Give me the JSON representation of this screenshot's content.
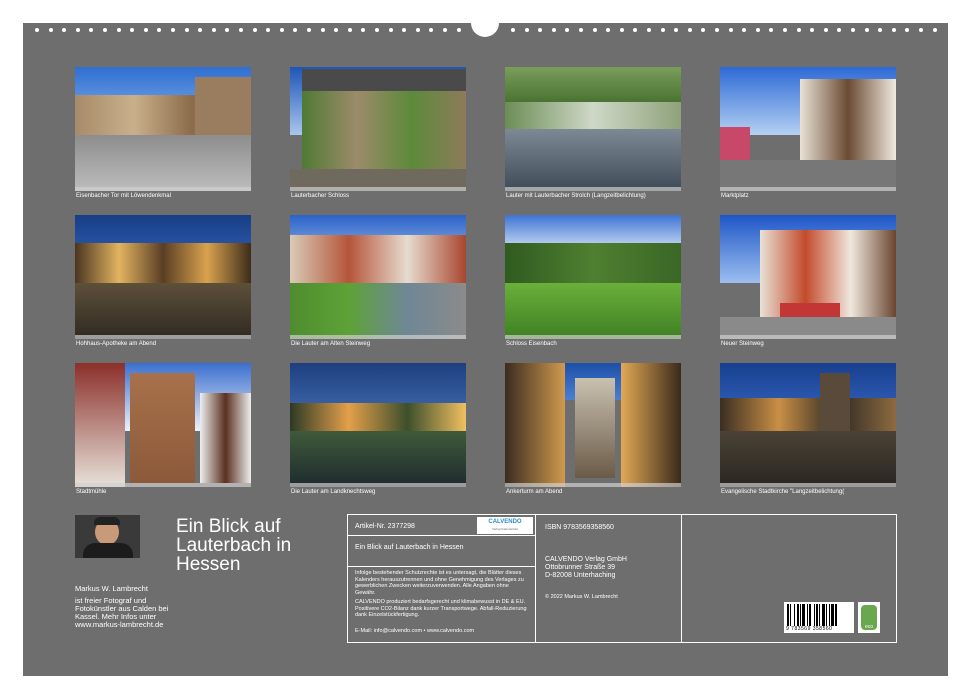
{
  "captions": [
    "Eisenbacher Tor mit Löwendenkmal",
    "Lauterbacher Schloss",
    "Lauter mit Lauterbacher Strolch (Langzeitbelichtung)",
    "Marktplatz",
    "Hohhaus-Apotheke am Abend",
    "Die Lauter am Alten Steinweg",
    "Schloss Eisenbach",
    "Neuer Steinweg",
    "Stadtmühle",
    "Die Lauter am Landknechtsweg",
    "Ankerturm am Abend",
    "Evangelische Stadtkirche \"Langzeitbelichtung("
  ],
  "title": "Ein Blick auf Lauterbach in Hessen",
  "author": {
    "name": "Markus W. Lambrecht",
    "bio": "ist freier Fotograf und Fotokünstler aus Calden bei Kassel. Mehr Infos unter www.markus-lambrecht.de"
  },
  "info": {
    "article_label": "Artikel-Nr. 2377298",
    "logo_text": "CALVENDO",
    "logo_sub": "Verlag Kalendertitel",
    "product_title": "Ein Blick auf Lauterbach in Hessen",
    "legal": "Infolge bestehender Schutzrechte ist es untersagt, die Blätter dieses Kalenders herauszutrennen und ohne Genehmigung des Verlages zu gewerblichen Zwecken weiterzuverwenden. Alle Angaben ohne Gewähr.",
    "eco_note": "CALVENDO produziert bedarfsgerecht und klimabewusst in DE & EU. Positivere CO2-Bilanz dank kurzer Transportwege. Abfall-Reduzierung dank Einzelstückfertigung.",
    "contact": "E-Mail: info@calvendo.com • www.calvendo.com",
    "isbn": "ISBN 9783569358560",
    "publisher": "CALVENDO Verlag GmbH",
    "street": "Ottobrunner Straße 39",
    "city": "D-82008 Unterhaching",
    "copyright": "© 2022 Markus W. Lambrecht",
    "barcode_digits": "9 783569 358560",
    "eco_label": "eco"
  },
  "colors": {
    "background": "#6e6e6e",
    "text": "#ffffff",
    "brand": "#2a8fc8"
  }
}
